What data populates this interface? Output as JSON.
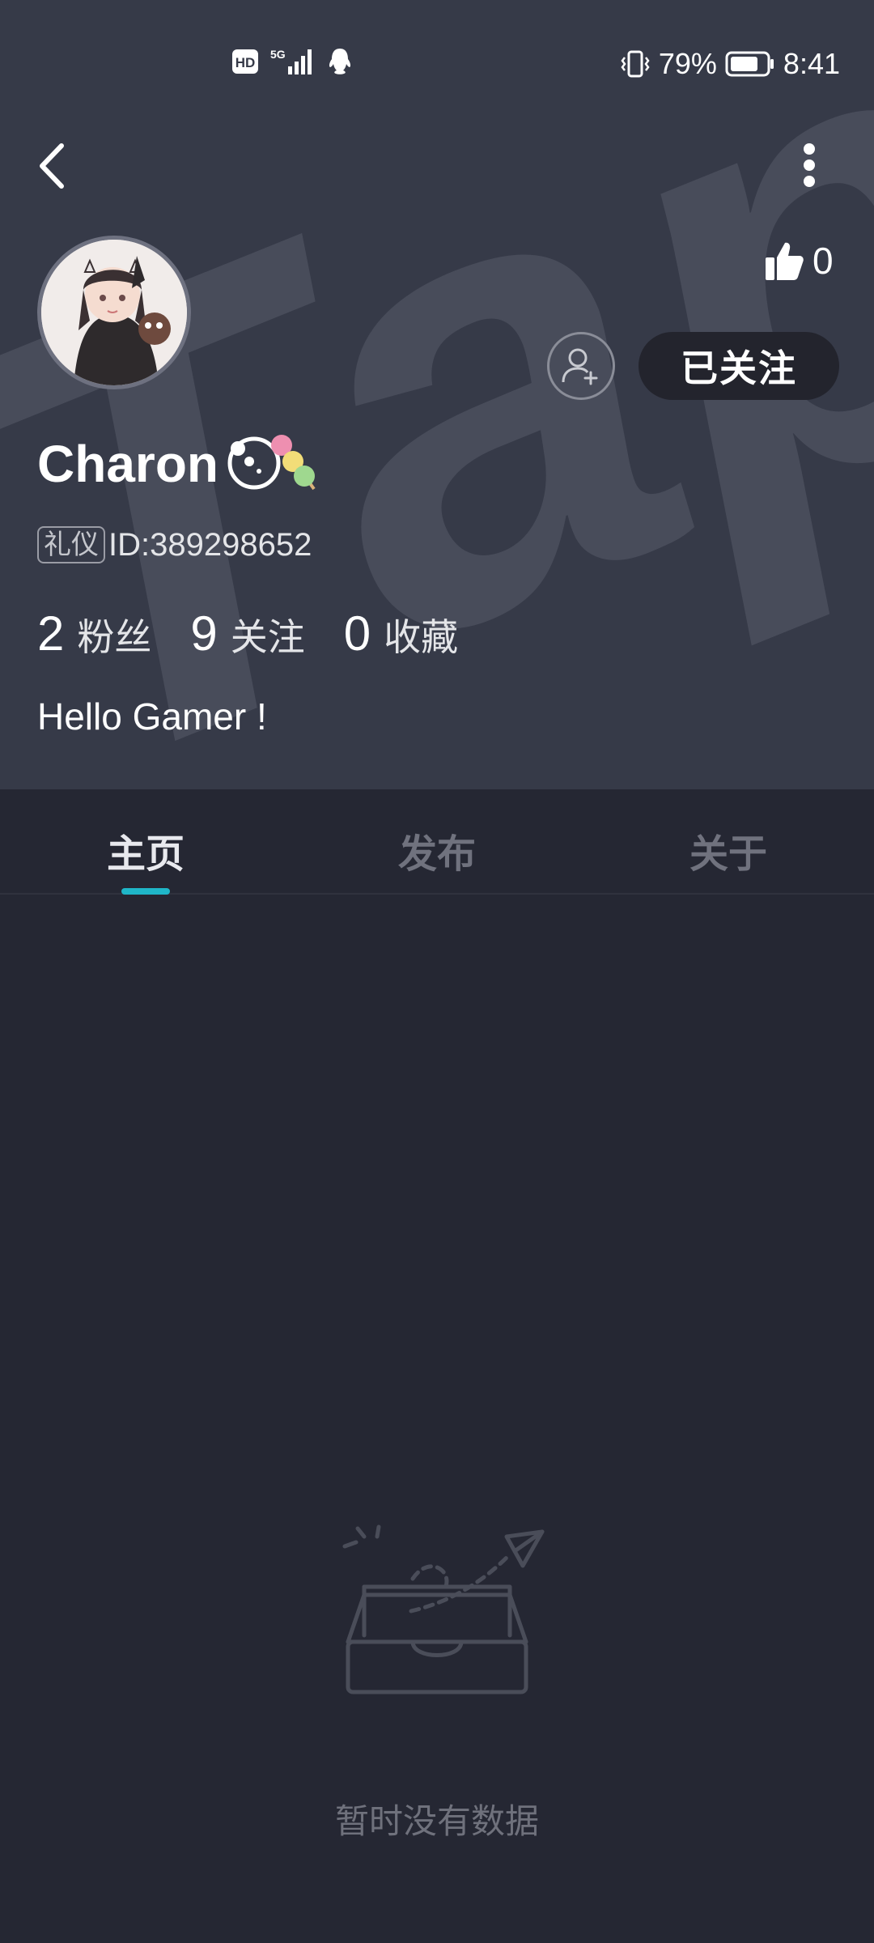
{
  "status_bar": {
    "network": "5G",
    "hd_badge": "HD",
    "battery_percent": "79%",
    "battery_level": 0.79,
    "time": "8:41",
    "icons": [
      "hd-icon",
      "signal-5g-icon",
      "qq-icon",
      "vibrate-icon",
      "battery-icon"
    ]
  },
  "nav": {
    "back_icon": "chevron-left-icon",
    "more_icon": "more-vertical-icon"
  },
  "profile": {
    "watermark": "TapTap",
    "like_count": "0",
    "add_friend_icon": "add-friend-icon",
    "follow_label": "已关注",
    "username": "Charon",
    "name_badge_icon": "dango-badge-icon",
    "etiquette_tag": "礼仪",
    "user_id": "ID:389298652",
    "stats": [
      {
        "value": "2",
        "label": "粉丝"
      },
      {
        "value": "9",
        "label": "关注"
      },
      {
        "value": "0",
        "label": "收藏"
      }
    ],
    "bio": "Hello Gamer !"
  },
  "tabs": [
    {
      "label": "主页",
      "active": true
    },
    {
      "label": "发布",
      "active": false
    },
    {
      "label": "关于",
      "active": false
    }
  ],
  "empty_state": {
    "icon": "empty-inbox-icon",
    "text": "暂时没有数据"
  },
  "colors": {
    "header_bg": "#363a48",
    "page_bg": "#252733",
    "accent": "#1fb6c8",
    "follow_button_bg": "#23242d"
  }
}
